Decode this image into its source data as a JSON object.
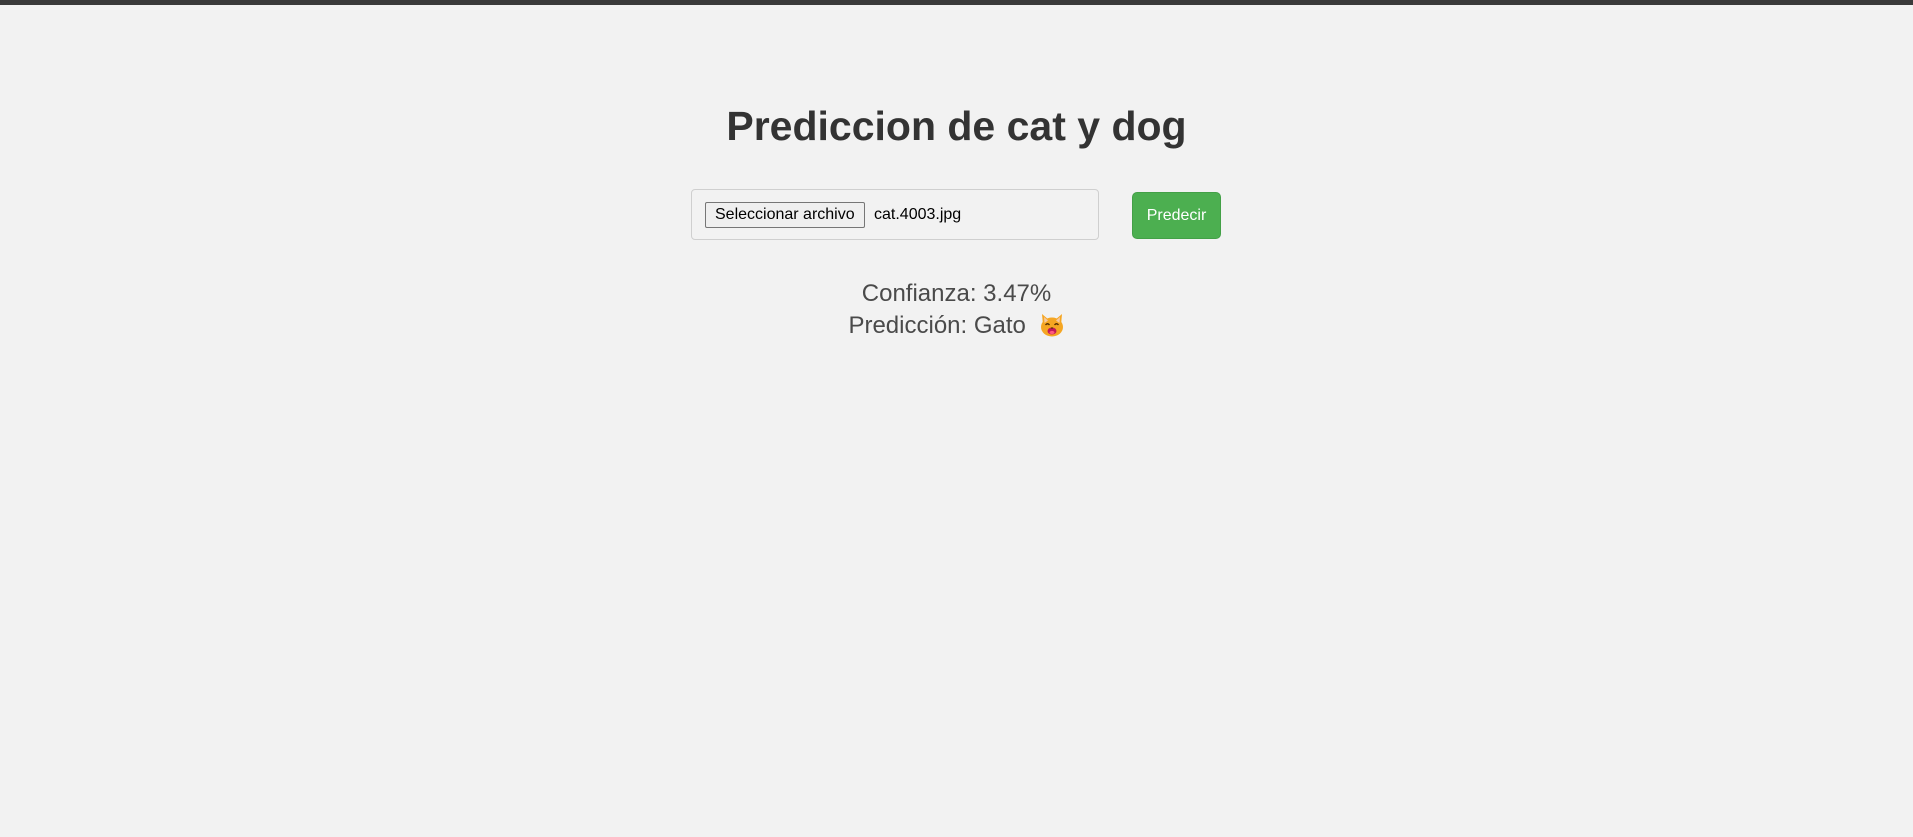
{
  "page": {
    "title": "Prediccion de cat y dog"
  },
  "upload": {
    "file_button_label": "Seleccionar archivo",
    "file_name": "cat.4003.jpg"
  },
  "actions": {
    "predict_label": "Predecir"
  },
  "result": {
    "confidence_text": "Confianza: 3.47%",
    "prediction_text": "Predicción: Gato",
    "prediction_icon": "cat-face-icon"
  },
  "colors": {
    "background": "#f2f2f2",
    "top_bar": "#3a3a3a",
    "predict_button": "#4caf50",
    "title_text": "#333333",
    "result_text": "#4a4a4a"
  }
}
